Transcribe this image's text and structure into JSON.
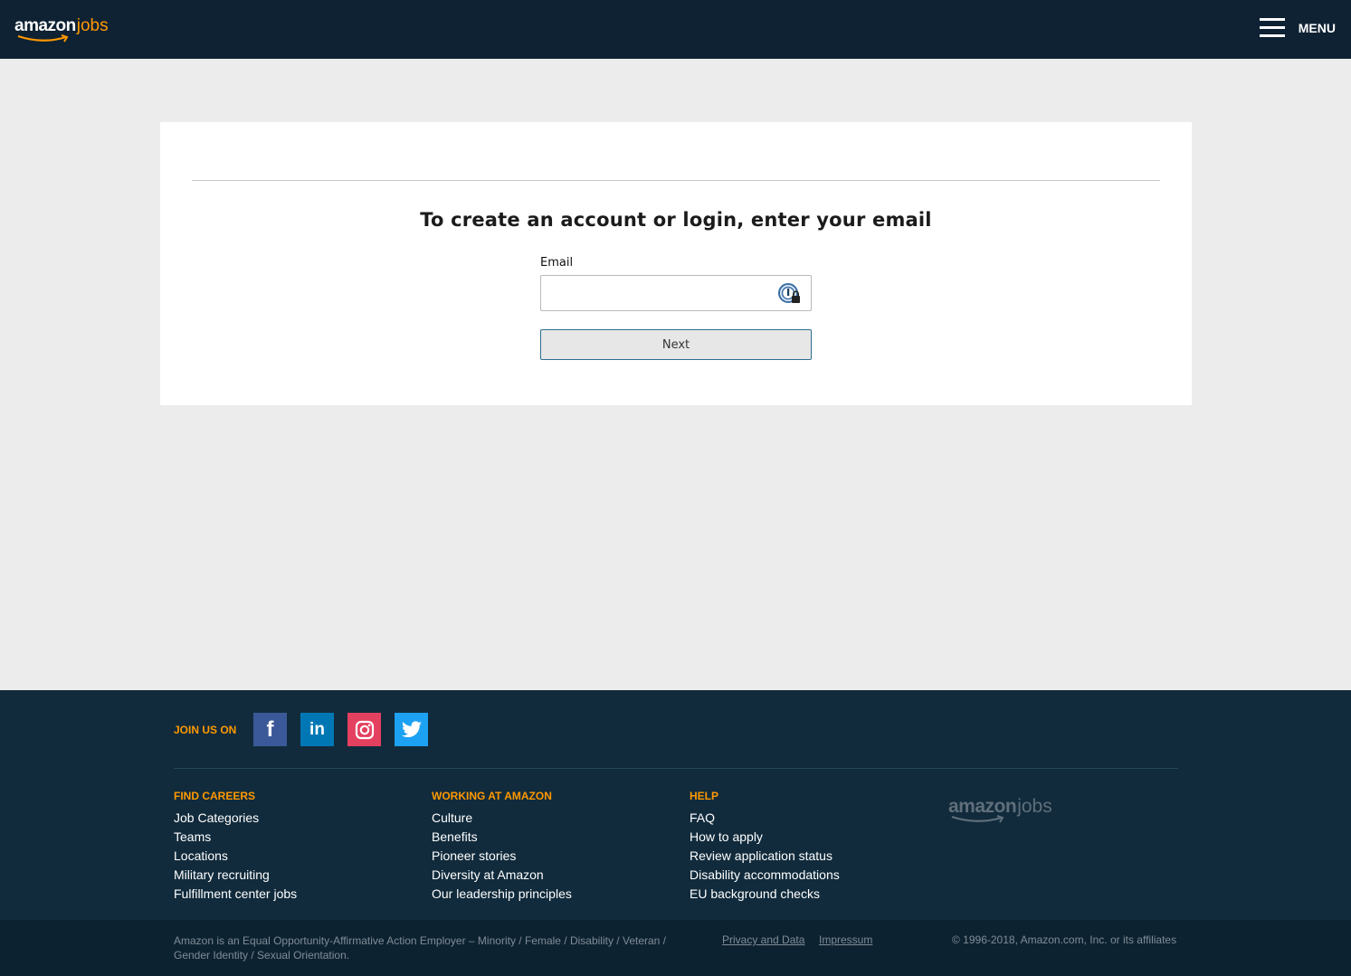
{
  "header": {
    "logo_word1": "amazon",
    "logo_word2": "jobs",
    "menu_label": "MENU"
  },
  "login": {
    "heading": "To create an account or login, enter your email",
    "email_label": "Email",
    "email_value": "",
    "next_label": "Next"
  },
  "footer": {
    "join_label": "JOIN US ON",
    "social": [
      "facebook",
      "linkedin",
      "instagram",
      "twitter"
    ],
    "columns": [
      {
        "heading": "FIND CAREERS",
        "links": [
          "Job Categories",
          "Teams",
          "Locations",
          "Military recruiting",
          "Fulfillment center jobs"
        ]
      },
      {
        "heading": "WORKING AT AMAZON",
        "links": [
          "Culture",
          "Benefits",
          "Pioneer stories",
          "Diversity at Amazon",
          "Our leadership principles"
        ]
      },
      {
        "heading": "HELP",
        "links": [
          "FAQ",
          "How to apply",
          "Review application status",
          "Disability accommodations",
          "EU background checks"
        ]
      }
    ],
    "logo_word1": "amazon",
    "logo_word2": "jobs",
    "eeo_text": "Amazon is an Equal Opportunity-Affirmative Action Employer – Minority / Female / Disability / Veteran / Gender Identity / Sexual Orientation.",
    "privacy_label": "Privacy and Data",
    "impressum_label": "Impressum",
    "copyright": "© 1996-2018, Amazon.com, Inc. or its affiliates"
  },
  "colors": {
    "header_bg": "#0f2233",
    "accent": "#ff9900",
    "footer_bg": "#112b3c"
  }
}
